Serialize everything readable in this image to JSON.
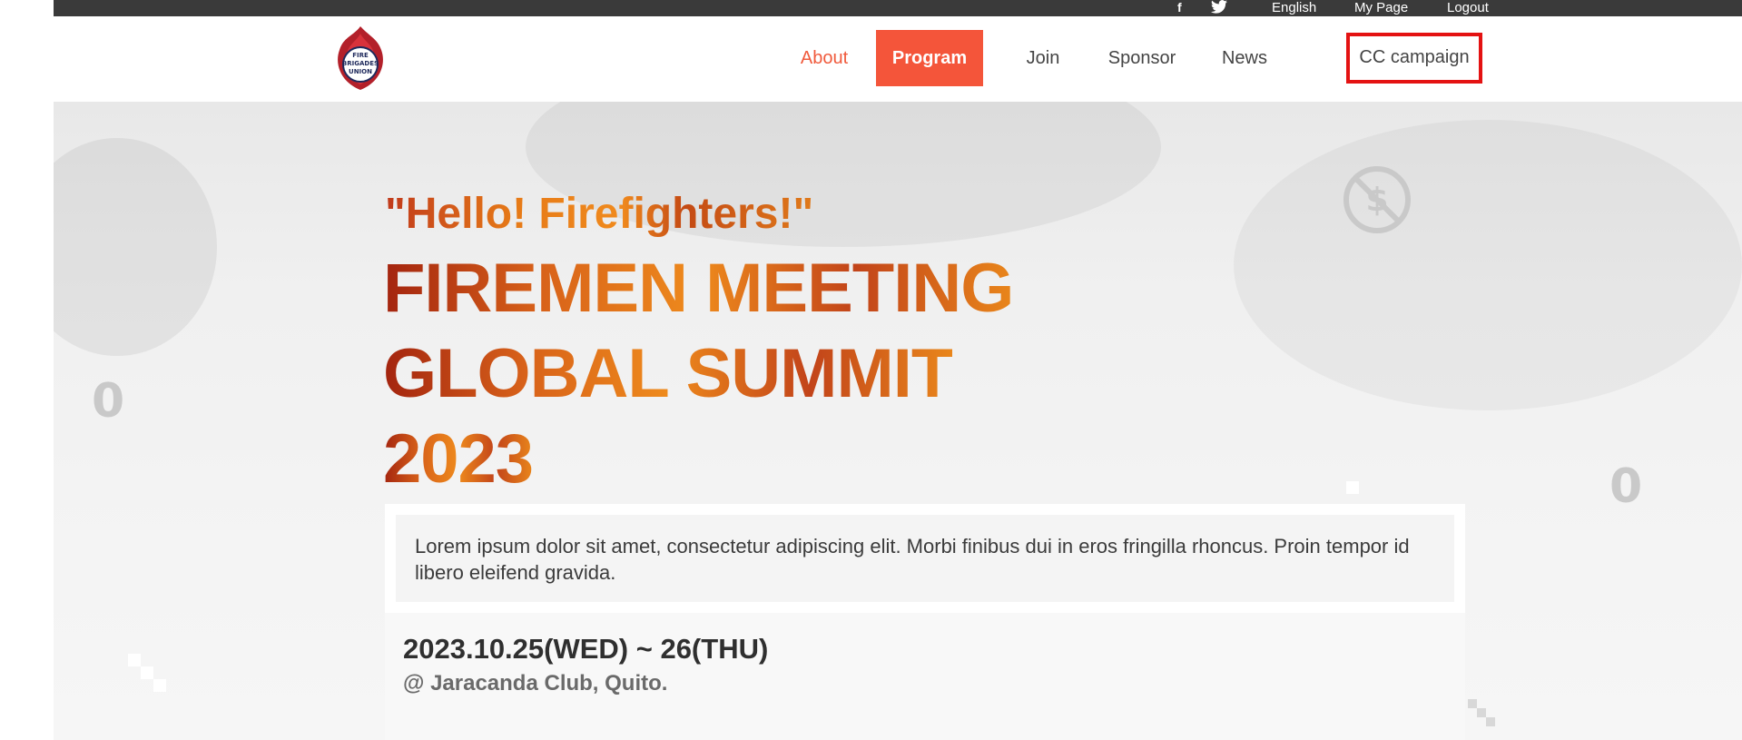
{
  "topbar": {
    "facebook_icon": "f",
    "twitter_icon": "twitter-bird",
    "language": "English",
    "mypage": "My Page",
    "logout": "Logout"
  },
  "header": {
    "logo_lines": [
      "FIRE",
      "BRIGADES",
      "UNION"
    ],
    "nav": [
      {
        "label": "About"
      },
      {
        "label": "Program"
      },
      {
        "label": "Join"
      },
      {
        "label": "Sponsor"
      },
      {
        "label": "News"
      },
      {
        "label": "CC campaign"
      }
    ]
  },
  "hero": {
    "greeting": "\"Hello! Firefighters!\"",
    "title_line1": "FIREMEN MEETING",
    "title_line2": "GLOBAL SUMMIT",
    "title_line3": "2023",
    "description": "Lorem ipsum dolor sit amet, consectetur adipiscing elit. Morbi finibus dui in eros fringilla rhoncus. Proin tempor id libero eleifend gravida.",
    "date": "2023.10.25(WED) ~ 26(THU)",
    "venue": "@ Jaracanda Club, Quito.",
    "deco_left": "0",
    "deco_right": "0"
  },
  "colors": {
    "topbar_bg": "#3a3a3a",
    "accent": "#f4553a",
    "highlight_border": "#e41212",
    "title_orange": "#e3781a"
  }
}
